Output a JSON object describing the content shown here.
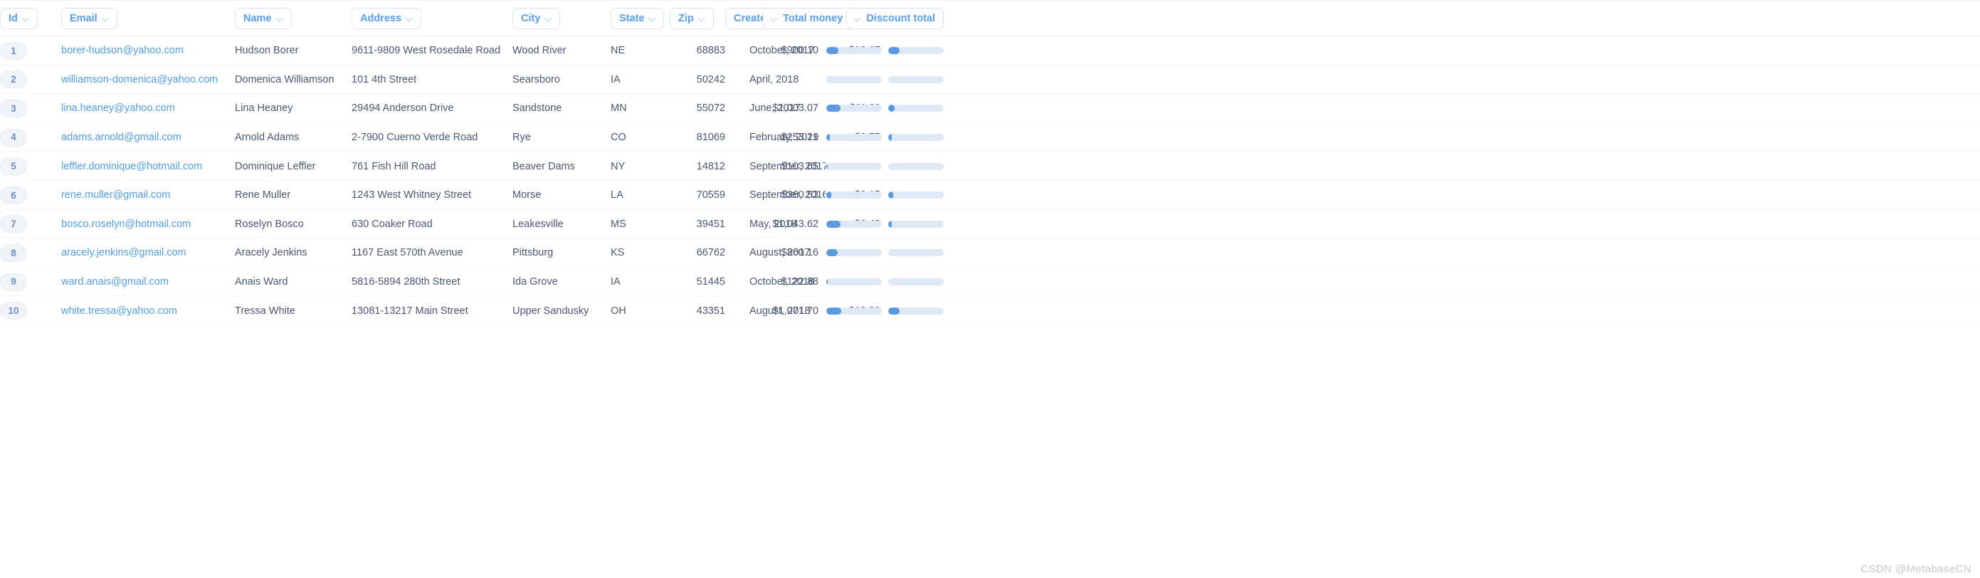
{
  "theme": {
    "link_blue": "#509ee3",
    "text_slate": "#4c5773",
    "bar_fill": "#5b9ae0",
    "bar_track": "#dfe9f5",
    "pill_bg": "#f0f4f9",
    "border": "#eef0f2"
  },
  "columns": [
    {
      "key": "id",
      "label": "Id",
      "align": "left",
      "chevron": "right"
    },
    {
      "key": "email",
      "label": "Email",
      "align": "left",
      "chevron": "right"
    },
    {
      "key": "name",
      "label": "Name",
      "align": "left",
      "chevron": "right"
    },
    {
      "key": "address",
      "label": "Address",
      "align": "left",
      "chevron": "right"
    },
    {
      "key": "city",
      "label": "City",
      "align": "left",
      "chevron": "right"
    },
    {
      "key": "state",
      "label": "State",
      "align": "left",
      "chevron": "right"
    },
    {
      "key": "zip",
      "label": "Zip",
      "align": "left",
      "chevron": "right"
    },
    {
      "key": "created",
      "label": "Created At: Month",
      "align": "left",
      "chevron": "right"
    },
    {
      "key": "money",
      "label": "Total money spent",
      "align": "right",
      "chevron": "left"
    },
    {
      "key": "discount",
      "label": "Discount total",
      "align": "right",
      "chevron": "left"
    }
  ],
  "rows": [
    {
      "id": "1",
      "email": "borer-hudson@yahoo.com",
      "name": "Hudson Borer",
      "address": "9611-9809 West Rosedale Road",
      "city": "Wood River",
      "state": "NE",
      "zip": "68883",
      "created": "October, 2017",
      "money": "$900.10",
      "money_pct": 22,
      "discount": "$18.67",
      "discount_pct": 20
    },
    {
      "id": "2",
      "email": "williamson-domenica@yahoo.com",
      "name": "Domenica Williamson",
      "address": "101 4th Street",
      "city": "Searsboro",
      "state": "IA",
      "zip": "50242",
      "created": "April, 2018",
      "money": "",
      "money_pct": 0,
      "discount": "",
      "discount_pct": 0
    },
    {
      "id": "3",
      "email": "lina.heaney@yahoo.com",
      "name": "Lina Heaney",
      "address": "29494 Anderson Drive",
      "city": "Sandstone",
      "state": "MN",
      "zip": "55072",
      "created": "June, 2017",
      "money": "$1,003.07",
      "money_pct": 25,
      "discount": "$11.60",
      "discount_pct": 12
    },
    {
      "id": "4",
      "email": "adams.arnold@gmail.com",
      "name": "Arnold Adams",
      "address": "2-7900 Cuerno Verde Road",
      "city": "Rye",
      "state": "CO",
      "zip": "81069",
      "created": "February, 2019",
      "money": "$253.21",
      "money_pct": 6,
      "discount": "$6.75",
      "discount_pct": 7
    },
    {
      "id": "5",
      "email": "leffler.dominique@hotmail.com",
      "name": "Dominique Leffler",
      "address": "761 Fish Hill Road",
      "city": "Beaver Dams",
      "state": "NY",
      "zip": "14812",
      "created": "September, 2017",
      "money": "$103.65",
      "money_pct": 3,
      "discount": "",
      "discount_pct": 0
    },
    {
      "id": "6",
      "email": "rene.muller@gmail.com",
      "name": "Rene Muller",
      "address": "1243 West Whitney Street",
      "city": "Morse",
      "state": "LA",
      "zip": "70559",
      "created": "September, 2016",
      "money": "$360.53",
      "money_pct": 9,
      "discount": "$9.15",
      "discount_pct": 9
    },
    {
      "id": "7",
      "email": "bosco.roselyn@hotmail.com",
      "name": "Roselyn Bosco",
      "address": "630 Coaker Road",
      "city": "Leakesville",
      "state": "MS",
      "zip": "39451",
      "created": "May, 2018",
      "money": "$1,043.62",
      "money_pct": 26,
      "discount": "$6.48",
      "discount_pct": 6
    },
    {
      "id": "8",
      "email": "aracely.jenkins@gmail.com",
      "name": "Aracely Jenkins",
      "address": "1167 East 570th Avenue",
      "city": "Pittsburg",
      "state": "KS",
      "zip": "66762",
      "created": "August, 2017",
      "money": "$860.16",
      "money_pct": 21,
      "discount": "",
      "discount_pct": 0
    },
    {
      "id": "9",
      "email": "ward.anais@gmail.com",
      "name": "Anais Ward",
      "address": "5816-5894 280th Street",
      "city": "Ida Grove",
      "state": "IA",
      "zip": "51445",
      "created": "October, 2018",
      "money": "$122.88",
      "money_pct": 3,
      "discount": "",
      "discount_pct": 0
    },
    {
      "id": "10",
      "email": "white.tressa@yahoo.com",
      "name": "Tressa White",
      "address": "13081-13217 Main Street",
      "city": "Upper Sandusky",
      "state": "OH",
      "zip": "43351",
      "created": "August, 2018",
      "money": "$1,071.70",
      "money_pct": 27,
      "discount": "$18.89",
      "discount_pct": 21
    }
  ],
  "watermark": "CSDN @MetabaseCN"
}
